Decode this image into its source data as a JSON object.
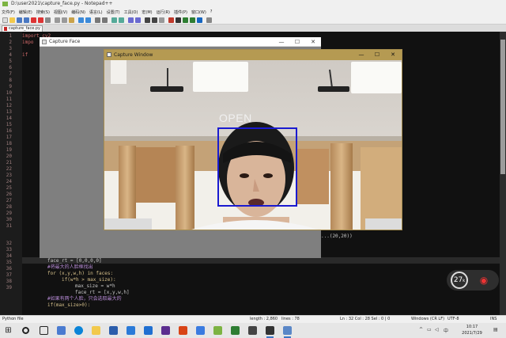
{
  "npp": {
    "title": "D:\\user2021\\capture_face.py - Notepad++",
    "menu": [
      "文件(F)",
      "编辑(E)",
      "搜索(S)",
      "视图(V)",
      "编码(N)",
      "语言(L)",
      "设置(T)",
      "工具(O)",
      "宏(M)",
      "运行(R)",
      "插件(P)",
      "窗口(W)",
      "?"
    ],
    "tab": "capture_face.py",
    "code": [
      {
        "n": "1",
        "text": "import cv2"
      },
      {
        "n": "2",
        "text": "impo"
      },
      {
        "n": "3",
        "text": ""
      },
      {
        "n": "4",
        "text": "if"
      },
      {
        "n": "28",
        "text": "...(20,20))"
      },
      {
        "n": "32",
        "text": "face_rt = [0,0,0,0]"
      },
      {
        "n": "33",
        "text": "#将最大的人脸框找出"
      },
      {
        "n": "34",
        "text": "for (x,y,w,h) in faces:"
      },
      {
        "n": "35",
        "text": "if(w*h > max_size):"
      },
      {
        "n": "36",
        "text": "max_size = w*h"
      },
      {
        "n": "37",
        "text": "face_rt = [x,y,w,h]"
      },
      {
        "n": "38",
        "text": "#如果有两个人脸，只会选取最大的"
      },
      {
        "n": "39",
        "text": "if(max_size>0):"
      }
    ],
    "gutter_numbers": [
      "1",
      "2",
      "3",
      "4",
      "5",
      "6",
      "7",
      "8",
      "9",
      "10",
      "11",
      "12",
      "13",
      "14",
      "15",
      "16",
      "17",
      "18",
      "19",
      "20",
      "21",
      "22",
      "23",
      "24",
      "25",
      "26",
      "27",
      "28",
      "29",
      "30",
      "31",
      "32",
      "33",
      "34",
      "35",
      "36",
      "37",
      "38",
      "39"
    ]
  },
  "capture_face_window": {
    "title": "Capture Face",
    "min": "—",
    "max": "☐",
    "close": "✕"
  },
  "capture_window": {
    "title": "Capture Window",
    "min": "—",
    "max": "☐",
    "close": "✕",
    "overlay_label": "OPEN",
    "box_color": "#1a1ad0"
  },
  "widget": {
    "speed": "27",
    "unit": "k"
  },
  "statusbar": {
    "lang": "Python file",
    "length": "length : 2,860",
    "lines": "lines : 78",
    "pos": "Ln : 32   Col : 28   Sel : 0 | 0",
    "eol": "Windows (CR LF)",
    "enc": "UTF-8",
    "ins": "INS"
  },
  "taskbar": {
    "time": "10:17",
    "date": "2021/7/29",
    "ime": "中"
  }
}
